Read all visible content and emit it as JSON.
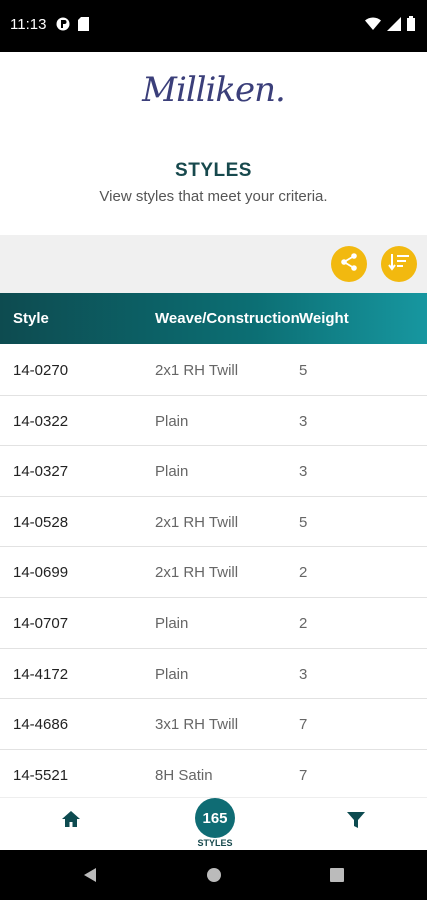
{
  "status_bar": {
    "time": "11:13"
  },
  "brand": {
    "logo_text": "Milliken."
  },
  "header": {
    "title": "STYLES",
    "subtitle": "View styles that meet your criteria."
  },
  "actions": {
    "share_icon": "share-icon",
    "sort_icon": "sort-icon"
  },
  "table": {
    "columns": [
      "Style",
      "Weave/Construction",
      "Weight"
    ],
    "rows": [
      {
        "style": "14-0270",
        "weave": "2x1 RH Twill",
        "weight": "5"
      },
      {
        "style": "14-0322",
        "weave": "Plain",
        "weight": "3"
      },
      {
        "style": "14-0327",
        "weave": "Plain",
        "weight": "3"
      },
      {
        "style": "14-0528",
        "weave": "2x1 RH Twill",
        "weight": "5"
      },
      {
        "style": "14-0699",
        "weave": "2x1 RH Twill",
        "weight": "2"
      },
      {
        "style": "14-0707",
        "weave": "Plain",
        "weight": "2"
      },
      {
        "style": "14-4172",
        "weave": "Plain",
        "weight": "3"
      },
      {
        "style": "14-4686",
        "weave": "3x1 RH Twill",
        "weight": "7"
      },
      {
        "style": "14-5521",
        "weave": "8H Satin",
        "weight": "7"
      }
    ]
  },
  "bottom_nav": {
    "count": "165",
    "count_label": "STYLES",
    "home_icon": "home-icon",
    "filter_icon": "filter-icon"
  },
  "colors": {
    "accent": "#f2b90f",
    "teal_dark": "#0d4b50",
    "teal": "#0f6c74",
    "title": "#17494d"
  }
}
